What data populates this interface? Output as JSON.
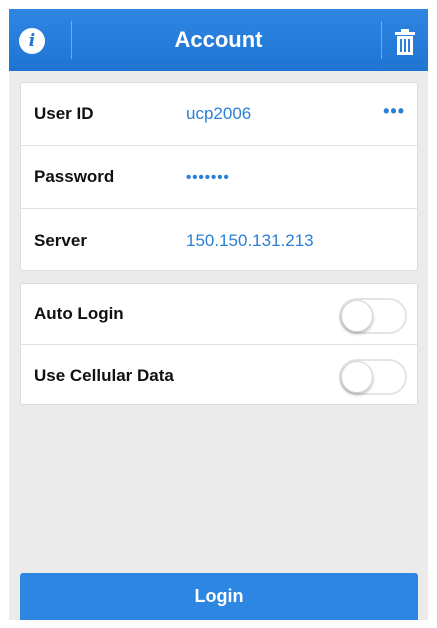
{
  "header": {
    "title": "Account"
  },
  "account": {
    "user_id_label": "User ID",
    "user_id_value": "ucp2006",
    "more_icon": "•••",
    "password_label": "Password",
    "password_value": "•••••••",
    "server_label": "Server",
    "server_value": "150.150.131.213"
  },
  "options": {
    "auto_login_label": "Auto Login",
    "auto_login_enabled": false,
    "cellular_label": "Use Cellular Data",
    "cellular_enabled": false
  },
  "login": {
    "label": "Login"
  },
  "colors": {
    "accent": "#2d86e2",
    "value_text": "#2a7fd6",
    "background": "#ebebeb"
  },
  "icons": {
    "info": "info-icon",
    "trash": "trash-icon",
    "more": "more-dots-icon"
  }
}
